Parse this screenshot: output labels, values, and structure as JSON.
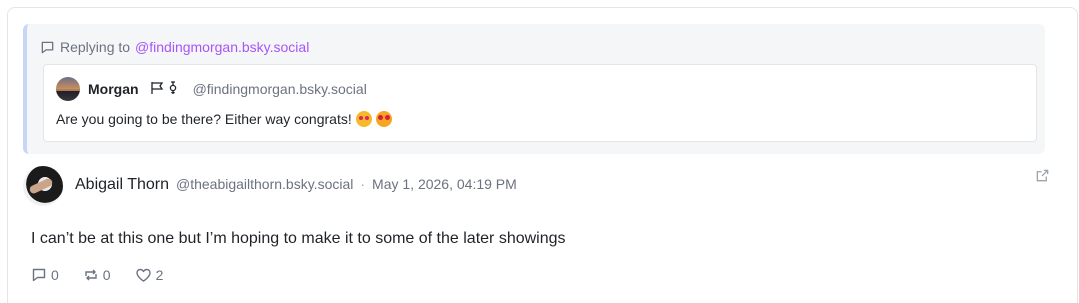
{
  "reply": {
    "prefix": "Replying to",
    "handle_link": "@findingmorgan.bsky.social"
  },
  "quoted_post": {
    "author_name": "Morgan",
    "author_handle": "@findingmorgan.bsky.social",
    "text": "Are you going to be there? Either way congrats!",
    "emojis": [
      "smiling-face-with-hearts-emoji",
      "star-struck-emoji"
    ],
    "flag_icons": [
      "flag-icon",
      "transgender-symbol-icon"
    ]
  },
  "post": {
    "author_name": "Abigail Thorn",
    "author_handle": "@theabigailthorn.bsky.social",
    "separator": "·",
    "timestamp": "May 1, 2026, 04:19 PM",
    "text": "I can’t be at this one but I’m hoping to make it to some of the later showings",
    "actions": {
      "reply_count": "0",
      "repost_count": "0",
      "like_count": "2"
    }
  },
  "colors": {
    "link": "#a855f7",
    "muted": "#6b7280",
    "reply_border": "#c8d6f5",
    "reply_bg": "#f5f6f8"
  }
}
